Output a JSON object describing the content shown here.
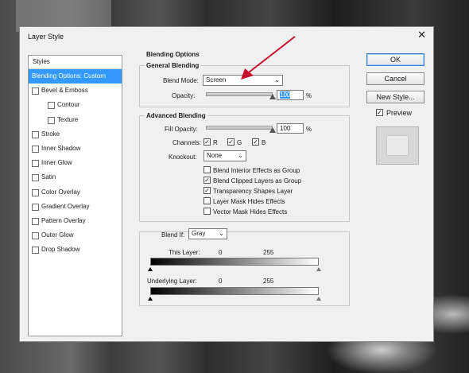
{
  "dialog": {
    "title": "Layer Style",
    "close_glyph": "✕"
  },
  "styles_panel": {
    "header": "Styles",
    "items": [
      {
        "label": "Blending Options: Custom",
        "checkbox": false,
        "selected": true,
        "sub": false
      },
      {
        "label": "Bevel & Emboss",
        "checkbox": true,
        "sub": false
      },
      {
        "label": "Contour",
        "checkbox": true,
        "sub": true
      },
      {
        "label": "Texture",
        "checkbox": true,
        "sub": true
      },
      {
        "label": "Stroke",
        "checkbox": true,
        "sub": false
      },
      {
        "label": "Inner Shadow",
        "checkbox": true,
        "sub": false
      },
      {
        "label": "Inner Glow",
        "checkbox": true,
        "sub": false
      },
      {
        "label": "Satin",
        "checkbox": true,
        "sub": false
      },
      {
        "label": "Color Overlay",
        "checkbox": true,
        "sub": false
      },
      {
        "label": "Gradient Overlay",
        "checkbox": true,
        "sub": false
      },
      {
        "label": "Pattern Overlay",
        "checkbox": true,
        "sub": false
      },
      {
        "label": "Outer Glow",
        "checkbox": true,
        "sub": false
      },
      {
        "label": "Drop Shadow",
        "checkbox": true,
        "sub": false
      }
    ]
  },
  "blending_options": {
    "group_title": "Blending Options",
    "general": {
      "title": "General Blending",
      "blend_mode_label": "Blend Mode:",
      "blend_mode_value": "Screen",
      "opacity_label": "Opacity:",
      "opacity_value": "100",
      "opacity_unit": "%",
      "opacity_level": 1.0
    },
    "advanced": {
      "title": "Advanced Blending",
      "fill_opacity_label": "Fill Opacity:",
      "fill_opacity_value": "100",
      "fill_opacity_unit": "%",
      "fill_opacity_level": 1.0,
      "channels_label": "Channels:",
      "channels": [
        {
          "label": "R",
          "checked": true
        },
        {
          "label": "G",
          "checked": true
        },
        {
          "label": "B",
          "checked": true
        }
      ],
      "knockout_label": "Knockout:",
      "knockout_value": "None",
      "options": [
        {
          "label": "Blend Interior Effects as Group",
          "checked": false
        },
        {
          "label": "Blend Clipped Layers as Group",
          "checked": true
        },
        {
          "label": "Transparency Shapes Layer",
          "checked": true
        },
        {
          "label": "Layer Mask Hides Effects",
          "checked": false
        },
        {
          "label": "Vector Mask Hides Effects",
          "checked": false
        }
      ]
    },
    "blend_if": {
      "label": "Blend If:",
      "value": "Gray",
      "this_layer_label": "This Layer:",
      "this_layer_min": "0",
      "this_layer_max": "255",
      "underlying_label": "Underlying Layer:",
      "underlying_min": "0",
      "underlying_max": "255"
    }
  },
  "buttons": {
    "ok": "OK",
    "cancel": "Cancel",
    "new_style": "New Style...",
    "preview_label": "Preview",
    "preview_checked": true
  },
  "icons": {
    "check": "✓",
    "chevron": "⌵",
    "checkbox_checked": "checkbox-checked-icon"
  },
  "colors": {
    "selection": "#3399ff",
    "arrow": "#c8102e"
  }
}
